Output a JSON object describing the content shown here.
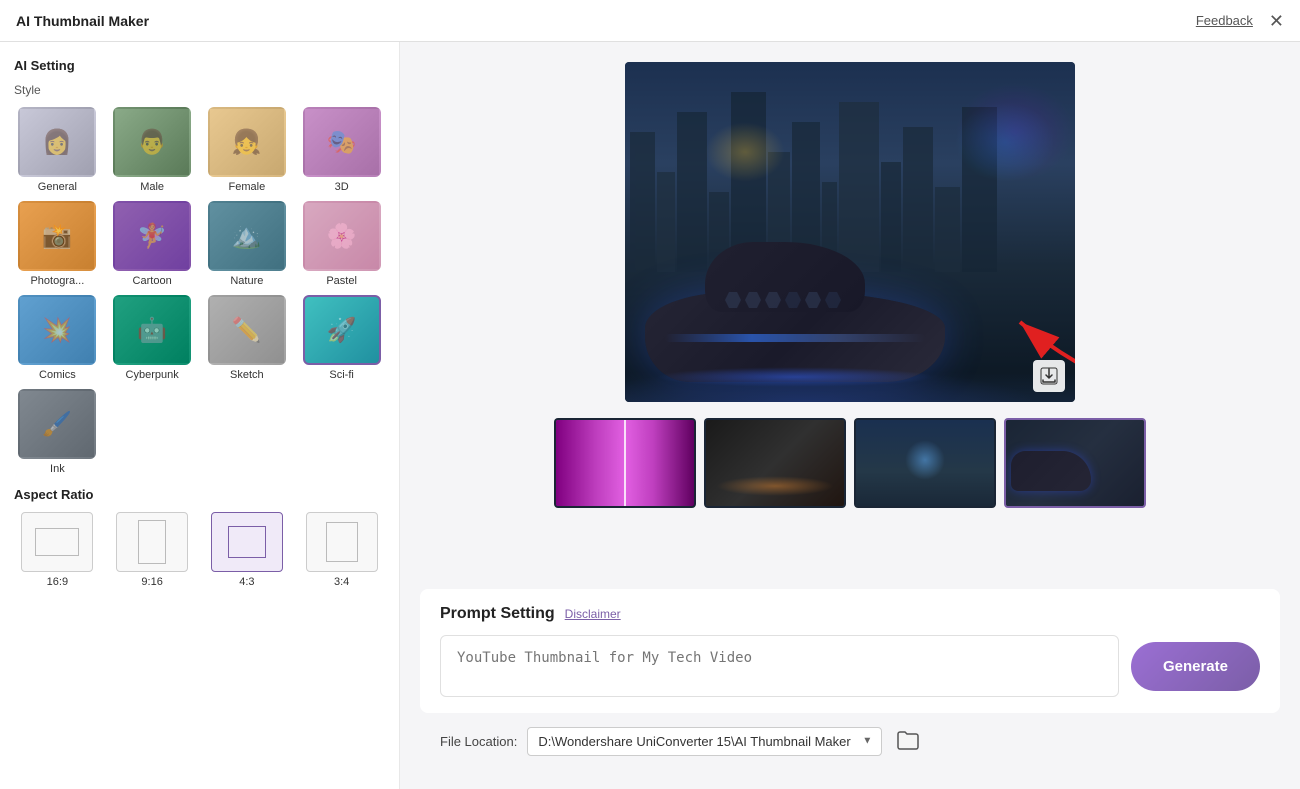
{
  "app": {
    "title": "AI Thumbnail Maker",
    "feedback_label": "Feedback",
    "close_icon": "✕"
  },
  "sidebar": {
    "ai_setting_label": "AI Setting",
    "style_label": "Style",
    "styles": [
      {
        "id": "general",
        "name": "General",
        "thumb_class": "thumb-general",
        "selected": false
      },
      {
        "id": "male",
        "name": "Male",
        "thumb_class": "thumb-male",
        "selected": false
      },
      {
        "id": "female",
        "name": "Female",
        "thumb_class": "thumb-female",
        "selected": false
      },
      {
        "id": "3d",
        "name": "3D",
        "thumb_class": "thumb-3d",
        "selected": false
      },
      {
        "id": "photogra",
        "name": "Photogra...",
        "thumb_class": "thumb-photogra",
        "selected": false
      },
      {
        "id": "cartoon",
        "name": "Cartoon",
        "thumb_class": "thumb-cartoon",
        "selected": false
      },
      {
        "id": "nature",
        "name": "Nature",
        "thumb_class": "thumb-nature",
        "selected": false
      },
      {
        "id": "pastel",
        "name": "Pastel",
        "thumb_class": "thumb-pastel",
        "selected": false
      },
      {
        "id": "comics",
        "name": "Comics",
        "thumb_class": "thumb-comics",
        "selected": false
      },
      {
        "id": "cyberpunk",
        "name": "Cyberpunk",
        "thumb_class": "thumb-cyberpunk",
        "selected": false
      },
      {
        "id": "sketch",
        "name": "Sketch",
        "thumb_class": "thumb-sketch",
        "selected": false
      },
      {
        "id": "scifi",
        "name": "Sci-fi",
        "thumb_class": "thumb-scifi",
        "selected": true
      },
      {
        "id": "ink",
        "name": "Ink",
        "thumb_class": "thumb-ink",
        "selected": false
      }
    ],
    "aspect_ratio_label": "Aspect Ratio",
    "aspect_ratios": [
      {
        "id": "16-9",
        "label": "16:9",
        "selected": false,
        "inner_class": "aspect-inner-16-9"
      },
      {
        "id": "9-16",
        "label": "9:16",
        "selected": false,
        "inner_class": "aspect-inner-9-16"
      },
      {
        "id": "4-3",
        "label": "4:3",
        "selected": true,
        "inner_class": "aspect-inner-4-3"
      },
      {
        "id": "3-4",
        "label": "3:4",
        "selected": false,
        "inner_class": "aspect-inner-3-4"
      }
    ]
  },
  "preview": {
    "thumbnails": [
      {
        "id": "t1",
        "thumb_class": "thumb-p1",
        "active": false
      },
      {
        "id": "t2",
        "thumb_class": "thumb-p2",
        "active": false
      },
      {
        "id": "t3",
        "thumb_class": "thumb-p3",
        "active": false
      },
      {
        "id": "t4",
        "thumb_class": "thumb-p4",
        "active": true
      }
    ]
  },
  "prompt": {
    "title": "Prompt Setting",
    "disclaimer_label": "Disclaimer",
    "placeholder": "YouTube Thumbnail for My Tech Video",
    "generate_label": "Generate"
  },
  "file_location": {
    "label": "File Location:",
    "path": "D:\\Wondershare UniConverter 15\\AI Thumbnail Maker",
    "folder_icon": "📁"
  }
}
